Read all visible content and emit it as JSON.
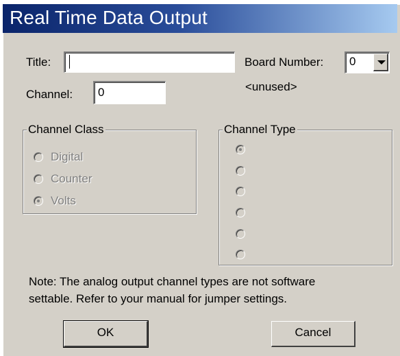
{
  "window": {
    "title": "Real Time Data Output"
  },
  "form": {
    "title_label": "Title:",
    "title_value": "",
    "board_number_label": "Board Number:",
    "board_number_value": "0",
    "unused_text": "<unused>",
    "channel_label": "Channel:",
    "channel_value": "0"
  },
  "channel_class": {
    "label": "Channel Class",
    "options": [
      "Digital",
      "Counter",
      "Volts"
    ],
    "selected": "Volts",
    "enabled": false
  },
  "channel_type": {
    "label": "Channel Type",
    "option_count": 6,
    "selected_index": 0,
    "enabled": false
  },
  "note": {
    "line1": "Note: The analog output channel types are not software",
    "line2": "settable.  Refer to your manual for jumper settings."
  },
  "buttons": {
    "ok": "OK",
    "cancel": "Cancel"
  },
  "colors": {
    "dialog_bg": "#d4d0c8",
    "title_gradient_start": "#0a246a",
    "title_gradient_end": "#a6caf0",
    "disabled_text": "#808080"
  }
}
